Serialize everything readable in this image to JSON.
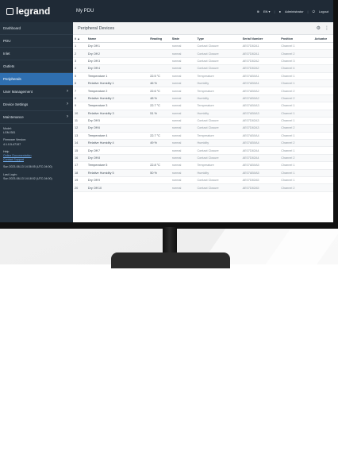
{
  "app": {
    "logo_text": "legrand",
    "device_name": "My PDU",
    "top_right": {
      "language": "EN ▾",
      "user": "Administrator",
      "logout": "Logout"
    }
  },
  "sidebar": {
    "items": [
      {
        "label": "Dashboard",
        "has_caret": false,
        "active": false
      },
      {
        "label": "PDU",
        "has_caret": false,
        "active": false
      },
      {
        "label": "Inlet",
        "has_caret": false,
        "active": false
      },
      {
        "label": "Outlets",
        "has_caret": false,
        "active": false
      },
      {
        "label": "Peripherals",
        "has_caret": false,
        "active": true
      },
      {
        "label": "User Management",
        "has_caret": true,
        "active": false
      },
      {
        "label": "Device Settings",
        "has_caret": true,
        "active": false
      },
      {
        "label": "Maintenance",
        "has_caret": true,
        "active": false
      }
    ],
    "info": {
      "model_label": "Model:",
      "model_value": "LGM-S81",
      "firmware_label": "Firmware Version:",
      "firmware_value": "4.1.0.5-47197",
      "help_label": "Help",
      "help_link_1": "Online Documentation",
      "help_link_2": "Contact Support",
      "session_1": "Sun 2023-08-13 14:36:05 (UTC-04:00)",
      "login_label": "Last Login:",
      "session_2": "Sun 2023-08-13 14:18:02 (UTC-04:00)"
    }
  },
  "panel": {
    "title": "Peripheral Devices",
    "gear_icon": "gear-icon",
    "more_icon": "more-icon"
  },
  "table": {
    "headers": [
      "# ▲",
      "Name",
      "Reading",
      "State",
      "Type",
      "Serial Number",
      "Position",
      "Actuator"
    ],
    "rows": [
      [
        "1",
        "Dry Off 1",
        "",
        "normal",
        "Contact Closure",
        "AE07D82A1",
        "Channel 1",
        ""
      ],
      [
        "2",
        "Dry Off 2",
        "",
        "normal",
        "Contact Closure",
        "AE07D82A1",
        "Channel 2",
        ""
      ],
      [
        "3",
        "Dry Off 3",
        "",
        "normal",
        "Contact Closure",
        "AE07D82A2",
        "Channel 3",
        ""
      ],
      [
        "4",
        "Dry Off 4",
        "",
        "normal",
        "Contact Closure",
        "AE07D82A2",
        "Channel 4",
        ""
      ],
      [
        "5",
        "Temperature 1",
        "22.5 °C",
        "normal",
        "Temperature",
        "AE07AB0A1",
        "Channel 1",
        ""
      ],
      [
        "6",
        "Relative Humidity 1",
        "46 %",
        "normal",
        "Humidity",
        "AE07AB0A1",
        "Channel 1",
        ""
      ],
      [
        "7",
        "Temperature 2",
        "22.6 °C",
        "normal",
        "Temperature",
        "AE07AB0A2",
        "Channel 2",
        ""
      ],
      [
        "8",
        "Relative Humidity 2",
        "48 %",
        "normal",
        "Humidity",
        "AE07AB0A2",
        "Channel 2",
        ""
      ],
      [
        "9",
        "Temperature 3",
        "22.7 °C",
        "normal",
        "Temperature",
        "AE07AB0A3",
        "Channel 1",
        ""
      ],
      [
        "10",
        "Relative Humidity 3",
        "51 %",
        "normal",
        "Humidity",
        "AE07AB0A3",
        "Channel 1",
        ""
      ],
      [
        "11",
        "Dry Off 5",
        "",
        "normal",
        "Contact Closure",
        "AE07D82A3",
        "Channel 1",
        ""
      ],
      [
        "12",
        "Dry Off 6",
        "",
        "normal",
        "Contact Closure",
        "AE07D82A3",
        "Channel 2",
        ""
      ],
      [
        "13",
        "Temperature 4",
        "22.7 °C",
        "normal",
        "Temperature",
        "AE07AB0A4",
        "Channel 1",
        ""
      ],
      [
        "14",
        "Relative Humidity 4",
        "49 %",
        "normal",
        "Humidity",
        "AE07AB0A4",
        "Channel 2",
        ""
      ],
      [
        "15",
        "Dry Off 7",
        "",
        "normal",
        "Contact Closure",
        "AE07D82A4",
        "Channel 1",
        ""
      ],
      [
        "16",
        "Dry Off 8",
        "",
        "normal",
        "Contact Closure",
        "AE07D82A4",
        "Channel 2",
        ""
      ],
      [
        "17",
        "Temperature 5",
        "22.8 °C",
        "normal",
        "Temperature",
        "AE07AB0A5",
        "Channel 1",
        ""
      ],
      [
        "18",
        "Relative Humidity 5",
        "50 %",
        "normal",
        "Humidity",
        "AE07AB0A5",
        "Channel 1",
        ""
      ],
      [
        "19",
        "Dry Off 9",
        "",
        "normal",
        "Contact Closure",
        "AE07D82A5",
        "Channel 1",
        ""
      ],
      [
        "20",
        "Dry Off 10",
        "",
        "normal",
        "Contact Closure",
        "AE07D82A5",
        "Channel 2",
        ""
      ]
    ]
  },
  "colors": {
    "topbar": "#1f2a36",
    "sidebar": "#24313d",
    "active": "#2f6fb0"
  }
}
